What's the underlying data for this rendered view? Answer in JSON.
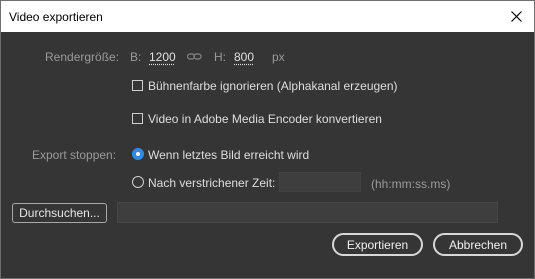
{
  "window": {
    "title": "Video exportieren"
  },
  "render_size": {
    "label": "Rendergröße:",
    "width_label": "B:",
    "width_value": "1200",
    "height_label": "H:",
    "height_value": "800",
    "unit": "px"
  },
  "options": {
    "ignore_stage_color": "Bühnenfarbe ignorieren (Alphakanal erzeugen)",
    "convert_media_encoder": "Video in Adobe Media Encoder konvertieren"
  },
  "stop_export": {
    "label": "Export stoppen:",
    "option_last_frame": "Wenn letztes Bild erreicht wird",
    "option_elapsed_time": "Nach verstrichener Zeit:",
    "time_value": "",
    "time_format": "(hh:mm:ss.ms)"
  },
  "browse": {
    "button_label": "Durchsuchen...",
    "path_value": ""
  },
  "actions": {
    "export_label": "Exportieren",
    "cancel_label": "Abbrechen"
  }
}
